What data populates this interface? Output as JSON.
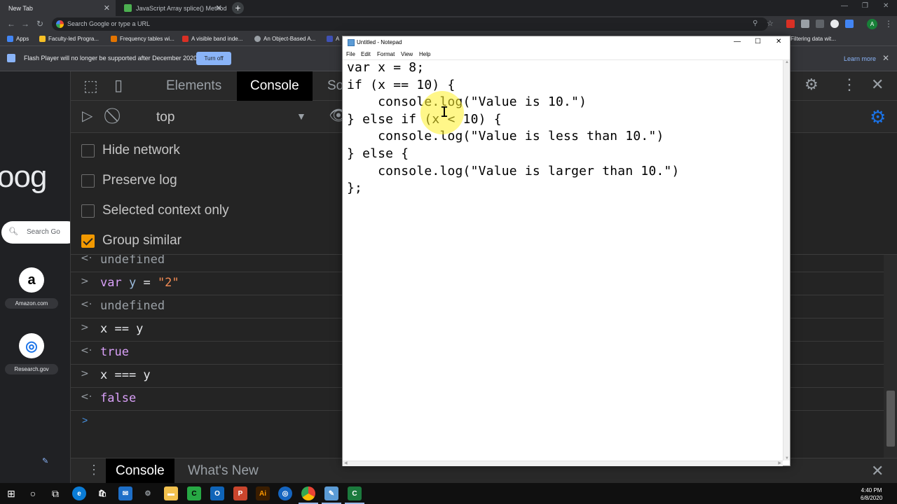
{
  "browser": {
    "tabs": [
      {
        "label": "New Tab",
        "active": true
      },
      {
        "label": "JavaScript Array splice() Method",
        "active": false
      }
    ],
    "omnibox_placeholder": "Search Google or type a URL",
    "profile_initial": "A",
    "bookmarks": [
      {
        "label": "Apps",
        "color": "#4285f4"
      },
      {
        "label": "Faculty-led Progra...",
        "color": "#f6c026"
      },
      {
        "label": "Frequency tables wi...",
        "color": "#e37400"
      },
      {
        "label": "A visible band inde...",
        "color": "#d93025"
      },
      {
        "label": "An Object-Based A...",
        "color": "#9aa0a6"
      },
      {
        "label": "A",
        "color": "#3f51b5"
      },
      {
        "label": "Filtering data wit...",
        "color": "#9aa0a6"
      }
    ]
  },
  "infobar": {
    "message": "Flash Player will no longer be supported after December 2020.",
    "turn_off_label": "Turn off",
    "learn_more_label": "Learn more"
  },
  "new_tab_page": {
    "logo_text": "oog",
    "search_placeholder": "Search Go",
    "tiles": [
      {
        "label": "Amazon.com",
        "glyph": "a"
      },
      {
        "label": "Research.gov",
        "glyph": "◎"
      }
    ]
  },
  "devtools": {
    "tabs": [
      "Elements",
      "Console",
      "So"
    ],
    "active_tab": "Console",
    "context": "top",
    "options": [
      {
        "label": "Hide network",
        "checked": false
      },
      {
        "label": "Preserve log",
        "checked": false
      },
      {
        "label": "Selected context only",
        "checked": false
      },
      {
        "label": "Group similar",
        "checked": true
      }
    ],
    "console_lines": {
      "l0": "undefined",
      "l1_kw": "var",
      "l1_id": "y",
      "l1_eq": " = ",
      "l1_str": "\"2\"",
      "l2": "undefined",
      "l3": "x == y",
      "l4": "true",
      "l5": "x === y",
      "l6": "false"
    },
    "drawer_tabs": [
      "Console",
      "What's New"
    ]
  },
  "notepad": {
    "title": "Untitled - Notepad",
    "menu": [
      "File",
      "Edit",
      "Format",
      "View",
      "Help"
    ],
    "code_lines": [
      "var x = 8;",
      "if (x == 10) {",
      "    console.log(\"Value is 10.\")",
      "} else if (x < 10) {",
      "    console.log(\"Value is less than 10.\")",
      "} else {",
      "    console.log(\"Value is larger than 10.\")",
      "};"
    ]
  },
  "taskbar": {
    "time": "4:40 PM",
    "date": "6/8/2020"
  }
}
